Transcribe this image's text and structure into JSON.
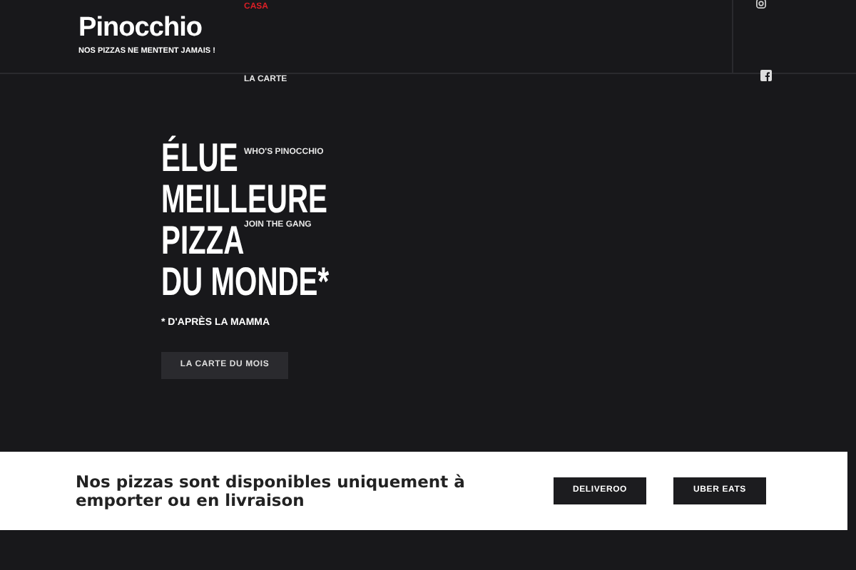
{
  "header": {
    "logo": "Pinocchio",
    "tagline": "NOS PIZZAS NE MENTENT JAMAIS !"
  },
  "nav": [
    {
      "label": "CASA",
      "selected": true
    },
    {
      "label": "LA CARTE",
      "selected": false
    },
    {
      "label": "WHO'S PINOCCHIO",
      "selected": false
    },
    {
      "label": "JOIN THE GANG",
      "selected": false
    }
  ],
  "hero": {
    "headline": [
      "ÉLUE",
      "MEILLEURE",
      "PIZZA",
      "DU MONDE*"
    ],
    "footnote": "* D'APRÈS LA MAMMA",
    "button": "LA CARTE DU MOIS"
  },
  "banner": {
    "text": "Nos pizzas sont disponibles uniquement à emporter ou en livraison",
    "buttons": [
      "DELIVEROO",
      "UBER EATS"
    ]
  }
}
